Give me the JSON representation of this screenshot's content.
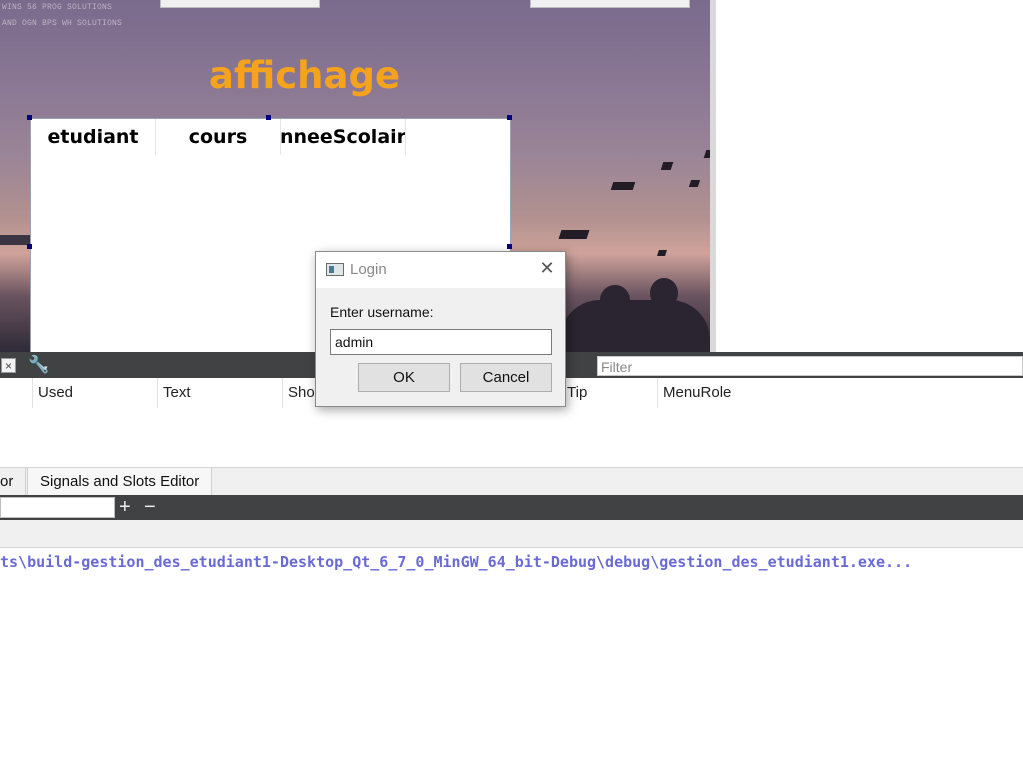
{
  "form": {
    "title": "affichage",
    "tiny_lines": [
      "WINS 56 PROG SOLUTIONS",
      "AND OGN BPS WH SOLUTIONS"
    ],
    "table_headers": [
      "etudiant",
      "cours",
      "nneeScolair"
    ]
  },
  "toolbar": {
    "filter_placeholder": "Filter",
    "close_glyph": "×",
    "wrench_glyph": "🔧"
  },
  "action_editor": {
    "columns": [
      "Used",
      "Text",
      "Shor",
      "Tip",
      "MenuRole"
    ]
  },
  "tabs": [
    {
      "label": "or"
    },
    {
      "label": "Signals and Slots Editor"
    }
  ],
  "buttons": {
    "plus": "+",
    "minus": "−"
  },
  "output": {
    "line": "ts\\build-gestion_des_etudiant1-Desktop_Qt_6_7_0_MinGW_64_bit-Debug\\debug\\gestion_des_etudiant1.exe..."
  },
  "dialog": {
    "title": "Login",
    "close_glyph": "✕",
    "prompt": "Enter username:",
    "input_value": "admin",
    "ok_label": "OK",
    "cancel_label": "Cancel"
  },
  "colors": {
    "title_orange": "#f5a31c",
    "output_blue": "#6a6ad6",
    "dark_bar": "#404244"
  },
  "icons": {
    "window_icon": "window-icon",
    "close_icon": "close-icon",
    "wrench_icon": "wrench-icon"
  }
}
